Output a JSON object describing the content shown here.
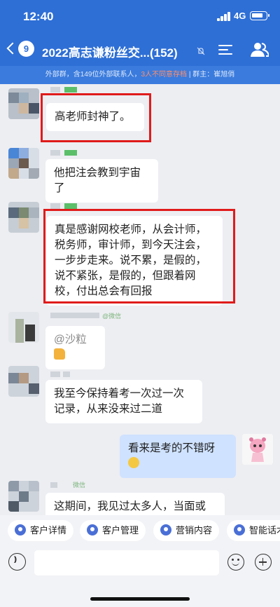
{
  "status_bar": {
    "time": "12:40",
    "network": "4G"
  },
  "header": {
    "unread_count": "9",
    "title": "2022高志谦粉丝交...(152)",
    "subtitle_prefix": "外部群，含149位外部联系人，",
    "subtitle_warning": "3人不同意存档",
    "subtitle_suffix": " | 群主：崔旭俏"
  },
  "messages": [
    {
      "side": "left",
      "text": "高老师封神了。",
      "highlighted": true
    },
    {
      "side": "left",
      "text": "他把注会教到宇宙了",
      "highlighted": false
    },
    {
      "side": "left",
      "text": "真是感谢网校老师，从会计师，税务师，审计师，到今天注会，一步步走来。说不累，是假的，说不紧张，是假的，但跟着网校，付出总会有回报",
      "highlighted": true
    },
    {
      "side": "left",
      "text": "@沙粒",
      "sender_tag": "@微信",
      "emoji": "thumbs-up"
    },
    {
      "side": "left",
      "text": "我至今保持着考一次过一次记录，从来没来过二道"
    },
    {
      "side": "right",
      "text": "看来是考的不错呀",
      "emoji": "smile-face"
    },
    {
      "side": "left",
      "text": "这期间，我见过太多人，当面或",
      "sender_tag": "微信"
    }
  ],
  "quick_actions": [
    "客户详情",
    "客户管理",
    "营销内容",
    "智能话术"
  ],
  "input": {
    "placeholder": ""
  },
  "colors": {
    "header": "#2e6fd6",
    "highlight": "#e01b1b",
    "self_bubble": "#cfe2ff"
  }
}
